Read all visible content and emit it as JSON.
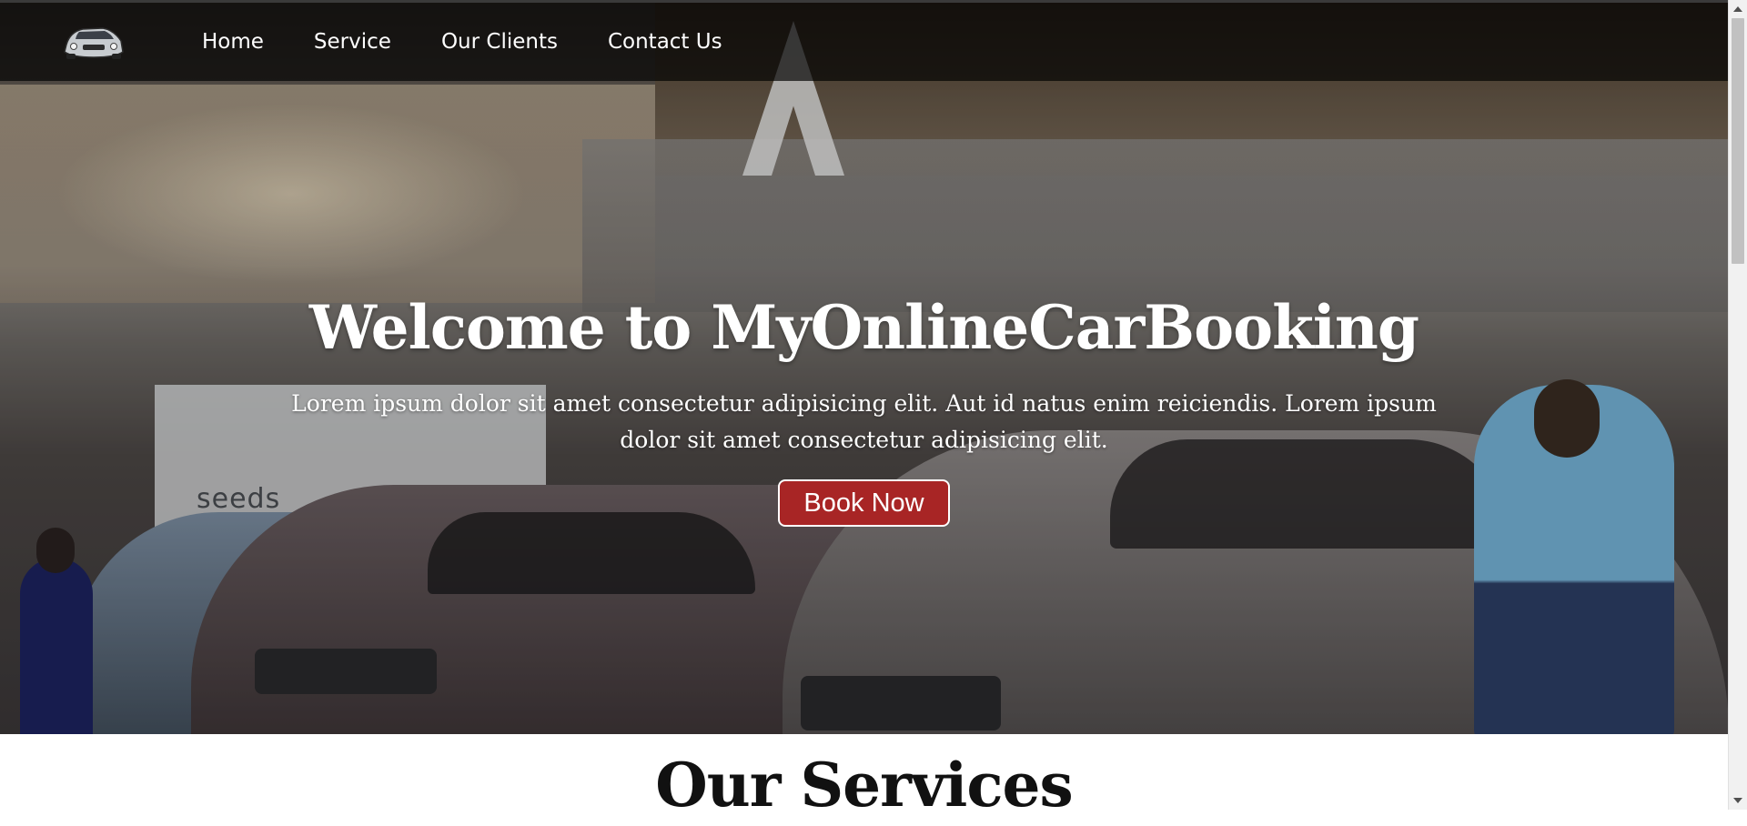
{
  "nav": {
    "logo_icon": "car-icon",
    "items": [
      {
        "label": "Home"
      },
      {
        "label": "Service"
      },
      {
        "label": "Our Clients"
      },
      {
        "label": "Contact Us"
      }
    ]
  },
  "hero": {
    "title": "Welcome to MyOnlineCarBooking",
    "subtitle": "Lorem ipsum dolor sit amet consectetur adipisicing elit. Aut id natus enim reiciendis. Lorem ipsum dolor sit amet consectetur adipisicing elit.",
    "background_sign": "seeds",
    "button_label": "Book Now",
    "button_color": "#a82525"
  },
  "services": {
    "title": "Our Services"
  }
}
